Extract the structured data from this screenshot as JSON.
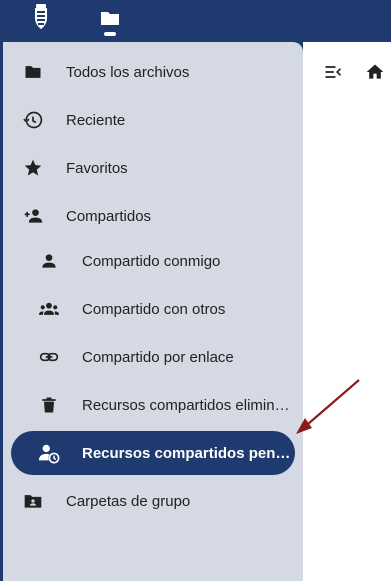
{
  "topbar": {
    "logo_icon": "coat-of-arms-icon",
    "app_icon": "folder-icon"
  },
  "navigation": {
    "items": [
      {
        "label": "Todos los archivos",
        "icon": "folder-icon"
      },
      {
        "label": "Reciente",
        "icon": "history-icon"
      },
      {
        "label": "Favoritos",
        "icon": "star-icon"
      },
      {
        "label": "Compartidos",
        "icon": "share-user-icon"
      },
      {
        "label": "Compartido conmigo",
        "icon": "person-icon"
      },
      {
        "label": "Compartido con otros",
        "icon": "group-icon"
      },
      {
        "label": "Compartido por enlace",
        "icon": "link-icon"
      },
      {
        "label": "Recursos compartidos eliminados",
        "icon": "trash-icon"
      },
      {
        "label": "Recursos compartidos pendientes",
        "icon": "person-clock-icon",
        "active": true
      },
      {
        "label": "Carpetas de grupo",
        "icon": "group-folder-icon"
      }
    ]
  },
  "content": {
    "toggle_icon": "menu-close-icon",
    "home_icon": "home-icon"
  },
  "colors": {
    "brand": "#1e3a6e",
    "sidebar": "#d5d9e3",
    "annotation_arrow": "#8b1a1a"
  }
}
